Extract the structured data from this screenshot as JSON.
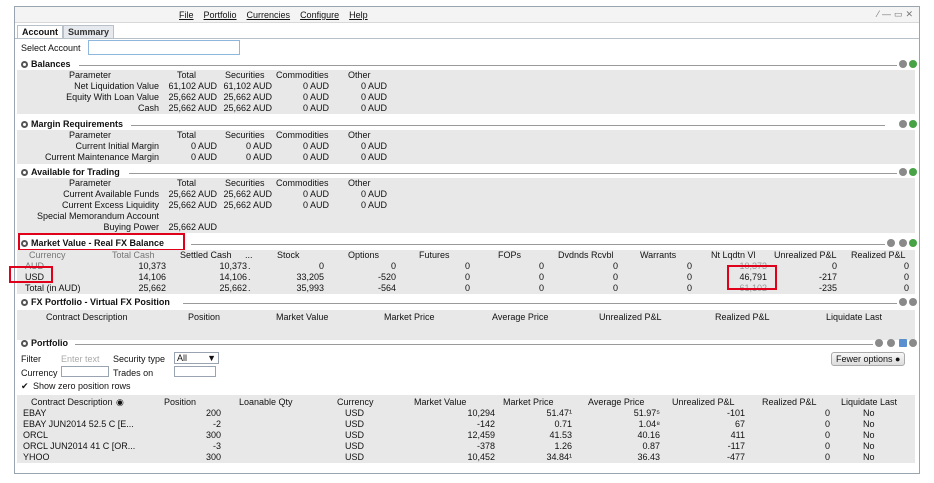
{
  "menu": [
    "File",
    "Portfolio",
    "Currencies",
    "Configure",
    "Help"
  ],
  "window_controls": [
    "⁄",
    "—",
    "▭",
    "✕"
  ],
  "tabs": [
    "Account",
    "Summary"
  ],
  "select_account_label": "Select Account",
  "balances": {
    "title": "Balances",
    "headers": [
      "Parameter",
      "Total",
      "Securities",
      "Commodities",
      "Other"
    ],
    "rows": [
      [
        "Net Liquidation Value",
        "61,102 AUD",
        "61,102 AUD",
        "0 AUD",
        "0 AUD"
      ],
      [
        "Equity With Loan Value",
        "25,662 AUD",
        "25,662 AUD",
        "0 AUD",
        "0 AUD"
      ],
      [
        "Cash",
        "25,662 AUD",
        "25,662 AUD",
        "0 AUD",
        "0 AUD"
      ]
    ]
  },
  "margin": {
    "title": "Margin Requirements",
    "headers": [
      "Parameter",
      "Total",
      "Securities",
      "Commodities",
      "Other"
    ],
    "rows": [
      [
        "Current Initial Margin",
        "0 AUD",
        "0 AUD",
        "0 AUD",
        "0 AUD"
      ],
      [
        "Current Maintenance Margin",
        "0 AUD",
        "0 AUD",
        "0 AUD",
        "0 AUD"
      ]
    ]
  },
  "trading": {
    "title": "Available for Trading",
    "headers": [
      "Parameter",
      "Total",
      "Securities",
      "Commodities",
      "Other"
    ],
    "rows": [
      [
        "Current Available Funds",
        "25,662 AUD",
        "25,662 AUD",
        "0 AUD",
        "0 AUD"
      ],
      [
        "Current Excess Liquidity",
        "25,662 AUD",
        "25,662 AUD",
        "0 AUD",
        "0 AUD"
      ],
      [
        "Special Memorandum Account",
        "",
        "",
        "",
        ""
      ],
      [
        "Buying Power",
        "25,662 AUD",
        "",
        "",
        ""
      ]
    ]
  },
  "market_value": {
    "title": "Market Value - Real FX Balance",
    "headers": [
      "Currency",
      "Total Cash",
      "Settled Cash",
      "...",
      "Stock",
      "Options",
      "Futures",
      "FOPs",
      "Dvdnds Rcvbl",
      "Warrants",
      "Nt Lqdtn Vl",
      "Unrealized P&L",
      "Realized P&L"
    ],
    "rows": [
      [
        "AUD",
        "10,373",
        "10,373",
        ".",
        "0",
        "0",
        "0",
        "0",
        "0",
        "0",
        "10,373",
        "0",
        "0"
      ],
      [
        "USD",
        "14,106",
        "14,106",
        ".",
        "33,205",
        "-520",
        "0",
        "0",
        "0",
        "0",
        "46,791",
        "-217",
        "0"
      ],
      [
        "Total (in AUD)",
        "25,662",
        "25,662",
        ".",
        "35,993",
        "-564",
        "0",
        "0",
        "0",
        "0",
        "61,102",
        "-235",
        "0"
      ]
    ]
  },
  "fx_portfolio": {
    "title": "FX Portfolio - Virtual FX Position",
    "headers": [
      "Contract Description",
      "Position",
      "Market Value",
      "Market Price",
      "Average Price",
      "Unrealized P&L",
      "Realized P&L",
      "Liquidate Last"
    ]
  },
  "portfolio": {
    "title": "Portfolio",
    "filter_label": "Filter",
    "filter_placeholder": "Enter text",
    "security_type_label": "Security type",
    "security_type_value": "All",
    "currency_label": "Currency",
    "trades_on_label": "Trades on",
    "show_zero_label": "Show zero position rows",
    "fewer_options": "Fewer options",
    "headers": [
      "Contract Description",
      "Position",
      "Loanable Qty",
      "Currency",
      "Market Value",
      "Market Price",
      "Average Price",
      "Unrealized P&L",
      "Realized P&L",
      "Liquidate Last"
    ],
    "rows": [
      [
        "EBAY",
        "200",
        "",
        "USD",
        "10,294",
        "51.47¹",
        "51.97⁵",
        "-101",
        "0",
        "No"
      ],
      [
        "EBAY  JUN2014 52.5 C [E...",
        "-2",
        "",
        "USD",
        "-142",
        "0.71",
        "1.04⁸",
        "67",
        "0",
        "No"
      ],
      [
        "ORCL",
        "300",
        "",
        "USD",
        "12,459",
        "41.53",
        "40.16",
        "411",
        "0",
        "No"
      ],
      [
        "ORCL  JUN2014 41 C [OR...",
        "-3",
        "",
        "USD",
        "-378",
        "1.26",
        "0.87",
        "-117",
        "0",
        "No"
      ],
      [
        "YHOO",
        "300",
        "",
        "USD",
        "10,452",
        "34.84¹",
        "36.43",
        "-477",
        "0",
        "No"
      ]
    ]
  }
}
